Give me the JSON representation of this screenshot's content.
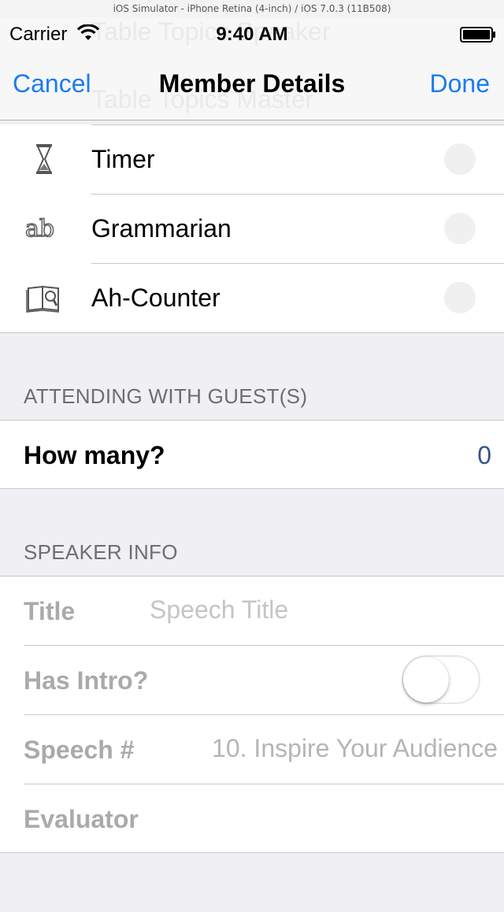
{
  "simulator_title": "iOS Simulator - iPhone Retina (4-inch) / iOS 7.0.3 (11B508)",
  "status_bar": {
    "carrier": "Carrier",
    "time": "9:40 AM"
  },
  "nav": {
    "cancel": "Cancel",
    "title": "Member Details",
    "done": "Done"
  },
  "ghost_rows": [
    "Table Topics Speaker",
    "Table Topics Master"
  ],
  "roles": [
    {
      "label": "Timer",
      "icon": "hourglass-icon",
      "selected": false
    },
    {
      "label": "Grammarian",
      "icon": "ab-letters-icon",
      "selected": false
    },
    {
      "label": "Ah-Counter",
      "icon": "book-magnifier-icon",
      "selected": false
    }
  ],
  "guests": {
    "header": "ATTENDING WITH GUEST(S)",
    "label": "How many?",
    "count": "0"
  },
  "speaker": {
    "header": "SPEAKER INFO",
    "title_label": "Title",
    "title_placeholder": "Speech Title",
    "intro_label": "Has Intro?",
    "intro_on": false,
    "speech_label": "Speech #",
    "speech_value": "10. Inspire Your Audience",
    "evaluator_label": "Evaluator",
    "evaluator_value": ""
  },
  "colors": {
    "accent": "#1a7cf0",
    "group_bg": "#efeff4",
    "value_blue": "#385487"
  }
}
